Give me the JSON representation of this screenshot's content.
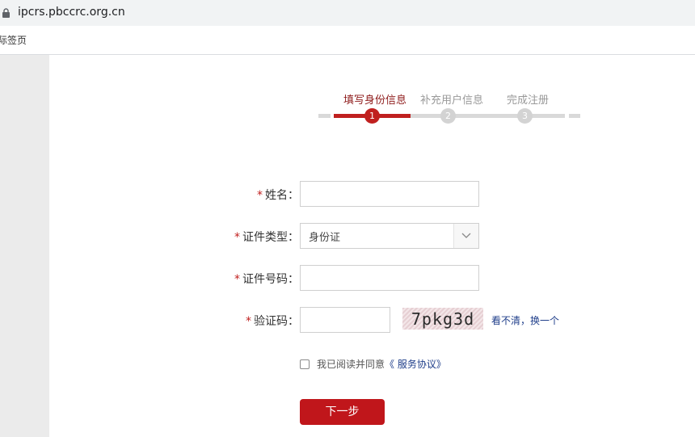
{
  "browser": {
    "url": "ipcrs.pbccrc.org.cn",
    "bookmark_text": "际签页"
  },
  "stepper": {
    "steps": [
      {
        "label": "填写身份信息",
        "number": "1"
      },
      {
        "label": "补充用户信息",
        "number": "2"
      },
      {
        "label": "完成注册",
        "number": "3"
      }
    ]
  },
  "form": {
    "required_mark": "*",
    "name_label": "姓名：",
    "id_type_label": "证件类型：",
    "id_type_value": "身份证",
    "id_number_label": "证件号码：",
    "captcha_label": "验证码：",
    "captcha_text": "7pkg3d",
    "refresh_unclear": "看不清",
    "refresh_sep": "，",
    "refresh_change": "换一个",
    "agree_text": "我已阅读并同意",
    "agree_link": "《 服务协议》",
    "next_button": "下一步"
  },
  "colors": {
    "accent": "#c0201f",
    "link": "#1f3e8a"
  }
}
